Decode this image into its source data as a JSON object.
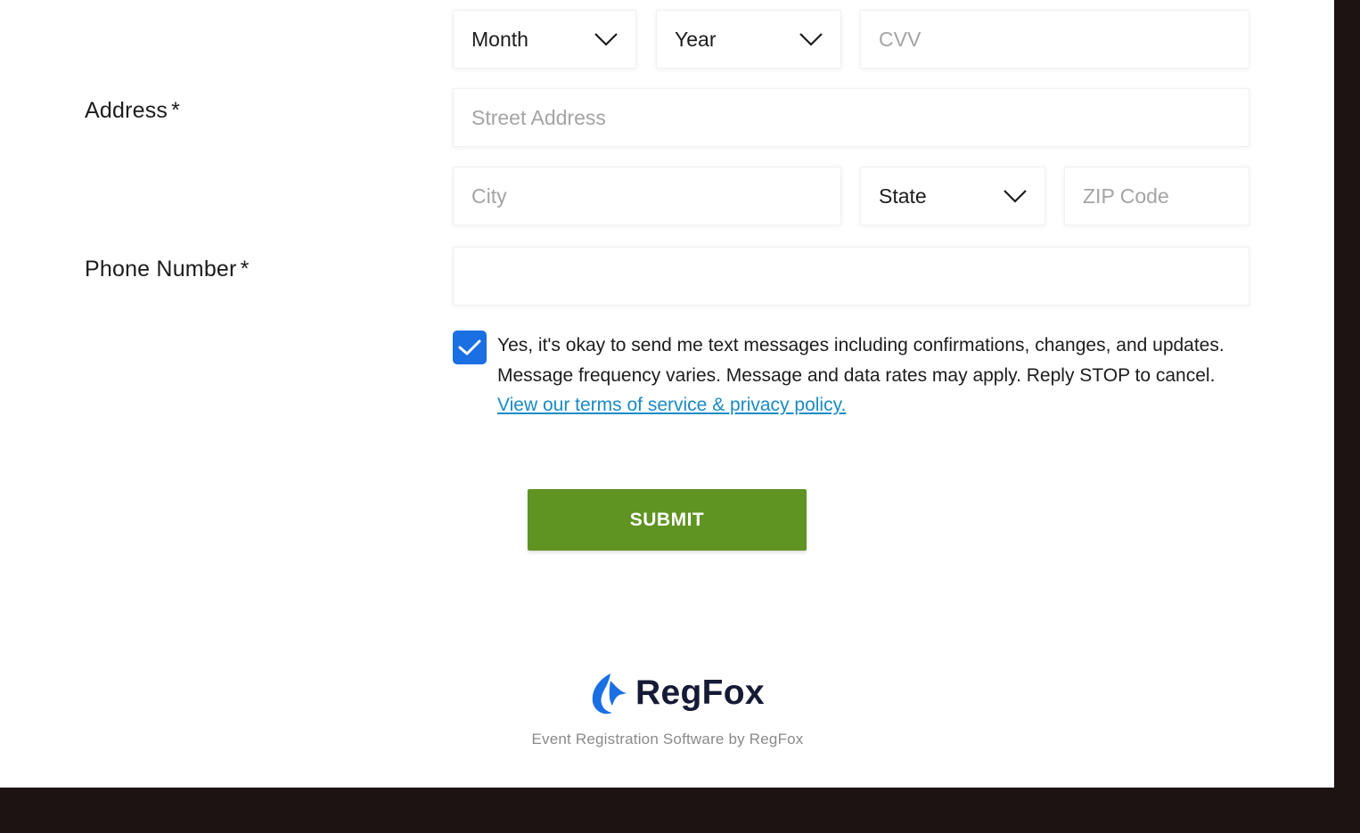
{
  "form": {
    "expiry_month": {
      "value": "Month"
    },
    "expiry_year": {
      "value": "Year"
    },
    "cvv": {
      "placeholder": "CVV"
    },
    "address": {
      "label": "Address",
      "required_mark": "*",
      "street_placeholder": "Street Address",
      "city_placeholder": "City",
      "state_value": "State",
      "zip_placeholder": "ZIP Code"
    },
    "phone": {
      "label": "Phone Number",
      "required_mark": "*",
      "value": ""
    },
    "consent": {
      "checked": true,
      "text": "Yes, it's okay to send me text messages including confirmations, changes, and updates. Message frequency varies. Message and data rates may apply. Reply STOP to cancel.",
      "link_text": "View our terms of service & privacy policy."
    },
    "submit_label": "SUBMIT"
  },
  "footer": {
    "brand_name": "RegFox",
    "tagline": "Event Registration Software by RegFox"
  },
  "colors": {
    "checkbox": "#1a6fe3",
    "submit": "#5f9322",
    "link": "#1a8bc4",
    "brand_text": "#161a35"
  },
  "icons": [
    "chevron-down-icon",
    "checkmark-icon",
    "regfox-logo-icon"
  ]
}
